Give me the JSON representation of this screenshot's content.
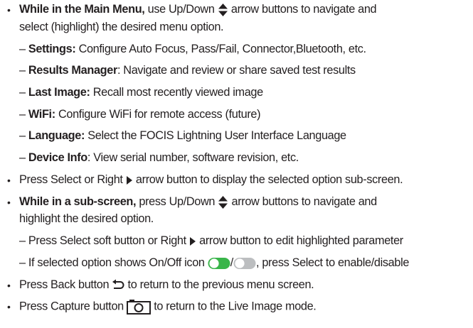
{
  "bullet_char": "•",
  "items": [
    {
      "bold": "While in the Main Menu,",
      "text_a": " use Up/Down ",
      "icon": "up-down-arrow-icon",
      "text_b": " arrow buttons to navigate and",
      "cont": "select (highlight) the desired menu option."
    },
    {
      "text_a": "Press Select or Right ",
      "icon": "right-triangle-icon",
      "text_b": " arrow button to display the selected option sub-screen."
    },
    {
      "bold": "While in a sub-screen,",
      "text_a": " press Up/Down ",
      "icon": "up-down-arrow-icon",
      "text_b": " arrow buttons to navigate and",
      "cont": "highlight the desired option."
    },
    {
      "text_a": "Press Back button ",
      "icon": "back-arrow-icon",
      "text_b": " to return to the previous menu screen."
    },
    {
      "text_a": "Press Capture button ",
      "icon": "camera-icon",
      "text_b": " to return to the Live Image mode."
    }
  ],
  "main_menu_options": [
    {
      "dash": "– ",
      "label": "Settings:",
      "desc": " Configure Auto Focus, Pass/Fail, Connector,Bluetooth, etc."
    },
    {
      "dash": "– ",
      "label": "Results Manager",
      "desc": ": Navigate and review or share saved test results"
    },
    {
      "dash": "– ",
      "label": "Last Image:",
      "desc": " Recall most recently viewed image"
    },
    {
      "dash": "– ",
      "label": "WiFi:",
      "desc": " Configure WiFi for remote access (future)"
    },
    {
      "dash": "– ",
      "label": "Language:",
      "desc": " Select the FOCIS Lightning User Interface Language"
    },
    {
      "dash": "– ",
      "label": "Device Info",
      "desc": ": View serial number, software revision, etc."
    }
  ],
  "subscreen_options": [
    {
      "text_a": "– Press Select soft button or Right ",
      "icon": "right-triangle-icon",
      "text_b": " arrow button to edit highlighted parameter"
    },
    {
      "text_a": "– If selected option shows On/Off icon ",
      "icon": "toggle-on-icon",
      "sep": "/",
      "icon2": "toggle-off-icon",
      "text_b": ", press Select to enable/disable"
    }
  ],
  "colors": {
    "text": "#231f20",
    "toggle_on": "#39b54a",
    "toggle_off": "#bcbec0"
  }
}
